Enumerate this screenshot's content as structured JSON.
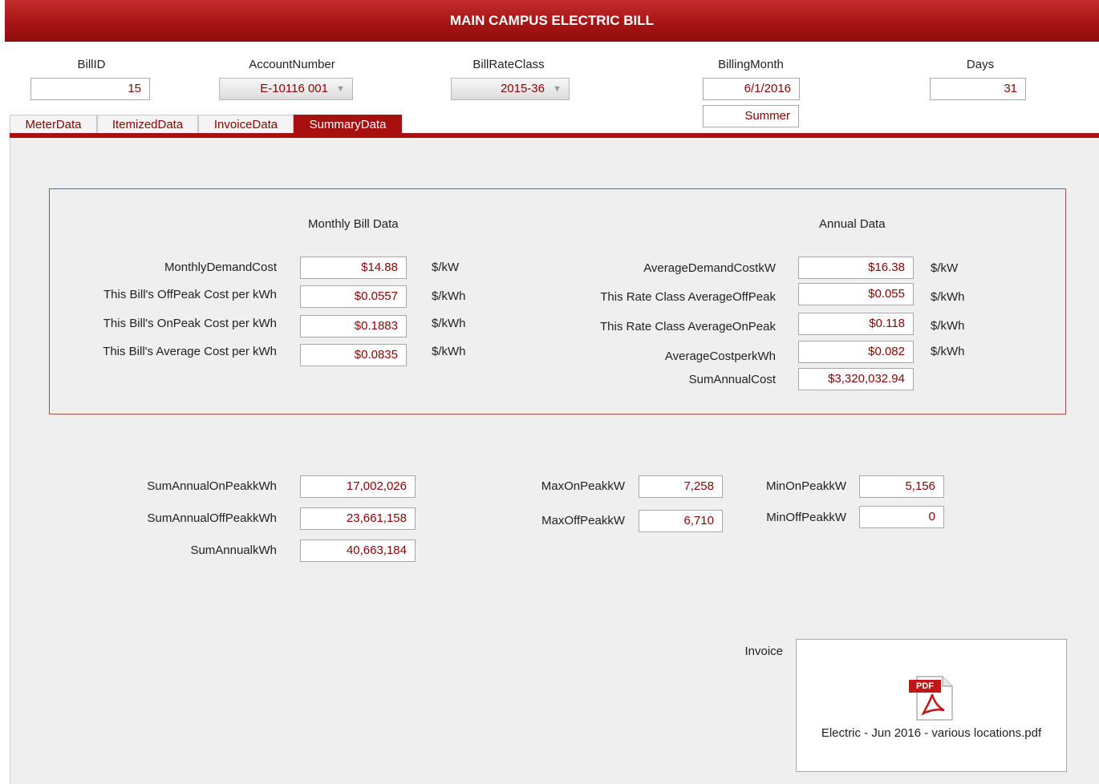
{
  "header": {
    "title": "MAIN CAMPUS ELECTRIC BILL"
  },
  "fields": {
    "bill_id": {
      "label": "BillID",
      "value": "15"
    },
    "account_number": {
      "label": "AccountNumber",
      "value": "E-10116 001"
    },
    "bill_rate_class": {
      "label": "BillRateClass",
      "value": "2015-36"
    },
    "billing_month": {
      "label": "BillingMonth",
      "value": "6/1/2016",
      "season": "Summer"
    },
    "days": {
      "label": "Days",
      "value": "31"
    }
  },
  "tabs": [
    {
      "label": "MeterData",
      "active": false
    },
    {
      "label": "ItemizedData",
      "active": false
    },
    {
      "label": "InvoiceData",
      "active": false
    },
    {
      "label": "SummaryData",
      "active": true
    }
  ],
  "monthly": {
    "heading": "Monthly Bill Data",
    "rows": [
      {
        "label": "MonthlyDemandCost",
        "value": "$14.88",
        "unit": "$/kW"
      },
      {
        "label": "This Bill's OffPeak  Cost per kWh",
        "value": "$0.0557",
        "unit": "$/kWh"
      },
      {
        "label": "This Bill's OnPeak Cost per kWh",
        "value": "$0.1883",
        "unit": "$/kWh"
      },
      {
        "label": "This Bill's Average Cost per kWh",
        "value": "$0.0835",
        "unit": "$/kWh"
      }
    ]
  },
  "annual": {
    "heading": "Annual Data",
    "rows": [
      {
        "label": "AverageDemandCostkW",
        "value": "$16.38",
        "unit": "$/kW"
      },
      {
        "label": "This Rate Class AverageOffPeak",
        "value": "$0.055",
        "unit": "$/kWh"
      },
      {
        "label": "This Rate Class AverageOnPeak",
        "value": "$0.118",
        "unit": "$/kWh"
      },
      {
        "label": "AverageCostperkWh",
        "value": "$0.082",
        "unit": "$/kWh"
      },
      {
        "label": "SumAnnualCost",
        "value": "$3,320,032.94",
        "unit": ""
      }
    ]
  },
  "sums": [
    {
      "label": "SumAnnualOnPeakkWh",
      "value": "17,002,026"
    },
    {
      "label": "SumAnnualOffPeakkWh",
      "value": "23,661,158"
    },
    {
      "label": "SumAnnualkWh",
      "value": "40,663,184"
    }
  ],
  "max": [
    {
      "label": "MaxOnPeakkW",
      "value": "7,258"
    },
    {
      "label": "MaxOffPeakkW",
      "value": "6,710"
    }
  ],
  "min": [
    {
      "label": "MinOnPeakkW",
      "value": "5,156"
    },
    {
      "label": "MinOffPeakkW",
      "value": "0"
    }
  ],
  "invoice": {
    "label": "Invoice",
    "icon_text": "PDF",
    "filename": "Electric - Jun 2016 -  various locations.pdf",
    "icon": "pdf-file-icon"
  },
  "colors": {
    "accent": "#a80f0f",
    "value_text": "#8b0000"
  }
}
